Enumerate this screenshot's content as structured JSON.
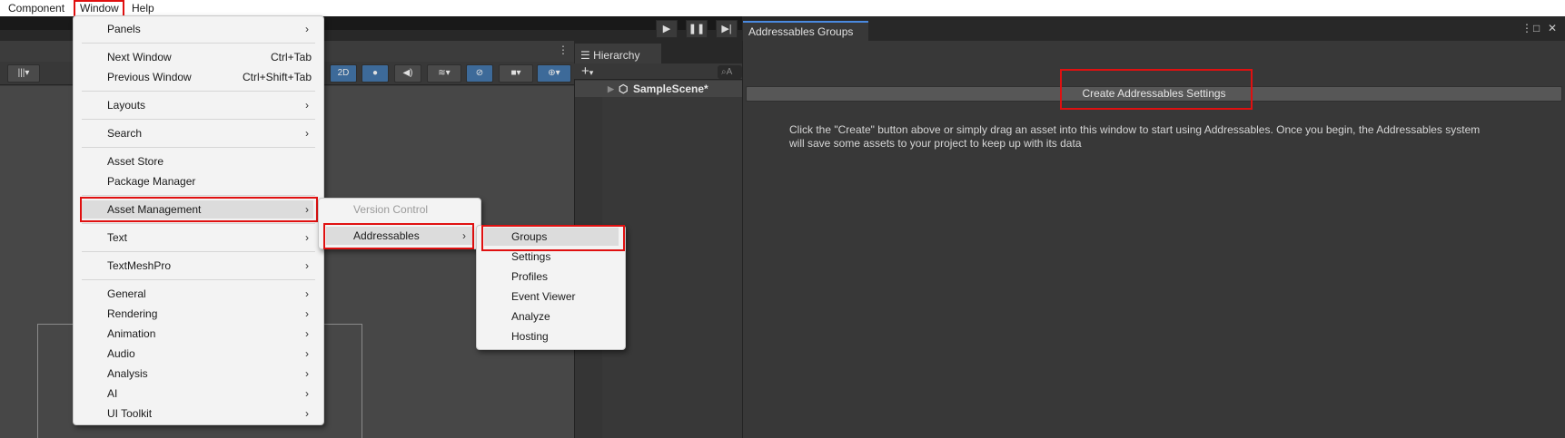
{
  "menubar": {
    "items": [
      "Component",
      "Window",
      "Help"
    ]
  },
  "toolbar": {
    "play_icon": "play-icon",
    "pause_icon": "pause-icon",
    "step_icon": "step-icon",
    "twod_label": "2D"
  },
  "hierarchy": {
    "tab_label": "Hierarchy",
    "add_label": "+",
    "search_placeholder": "A",
    "scene_name": "SampleScene*"
  },
  "addressables": {
    "tab_label": "Addressables Groups",
    "create_button": "Create Addressables Settings",
    "message": "Click the \"Create\" button above or simply drag an asset into this window to start using Addressables.  Once you begin, the Addressables system\nwill save some assets to your project to keep up with its data"
  },
  "window_menu": {
    "items": [
      {
        "label": "Panels"
      },
      {
        "label": "Next Window",
        "shortcut": "Ctrl+Tab"
      },
      {
        "label": "Previous Window",
        "shortcut": "Ctrl+Shift+Tab"
      },
      {
        "label": "Layouts"
      },
      {
        "label": "Search"
      },
      {
        "label": "Asset Store"
      },
      {
        "label": "Package Manager"
      },
      {
        "label": "Asset Management"
      },
      {
        "label": "Text"
      },
      {
        "label": "TextMeshPro"
      },
      {
        "label": "General"
      },
      {
        "label": "Rendering"
      },
      {
        "label": "Animation"
      },
      {
        "label": "Audio"
      },
      {
        "label": "Analysis"
      },
      {
        "label": "AI"
      },
      {
        "label": "UI Toolkit"
      }
    ]
  },
  "asset_mgmt_menu": {
    "items": [
      {
        "label": "Version Control"
      },
      {
        "label": "Addressables"
      }
    ]
  },
  "addressables_menu": {
    "items": [
      {
        "label": "Groups"
      },
      {
        "label": "Settings"
      },
      {
        "label": "Profiles"
      },
      {
        "label": "Event Viewer"
      },
      {
        "label": "Analyze"
      },
      {
        "label": "Hosting"
      }
    ]
  },
  "colors": {
    "highlight": "#e01010",
    "tab_accent": "#4a8ae0"
  }
}
